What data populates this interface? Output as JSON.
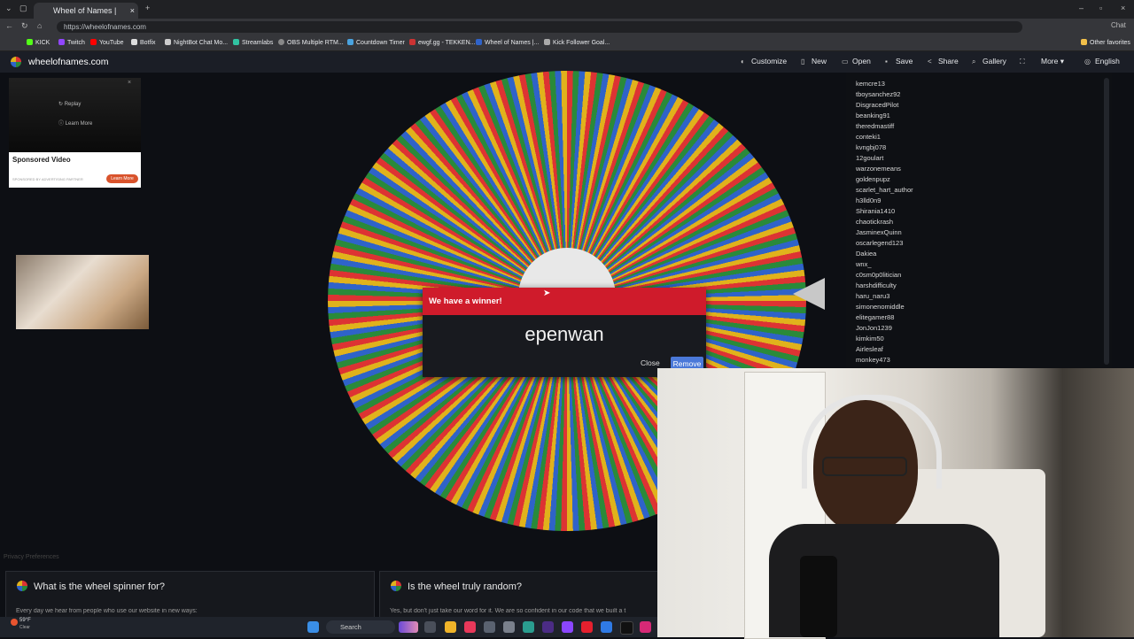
{
  "browser": {
    "tabs": [
      {
        "label": "Wheel of Names | Random name"
      }
    ],
    "url": "https://wheelofnames.com",
    "bookmarks": [
      "KICK",
      "Twitch",
      "YouTube",
      "Botfix",
      "NightBot Chat Mo...",
      "Streamlabs",
      "OBS Multiple RTM...",
      "Countdown Timer",
      "ewgf.gg - TEKKEN...",
      "Wheel of Names |...",
      "Kick Follower Goal..."
    ],
    "other_favorites": "Other favorites",
    "chat_label": "Chat",
    "colors": {
      "chrome_dark": "#202124",
      "chrome_mid": "#35363a"
    }
  },
  "site": {
    "logo": "wheelofnames.com",
    "nav": [
      {
        "label": "Customize",
        "icon": "palette-icon"
      },
      {
        "label": "New",
        "icon": "file-icon"
      },
      {
        "label": "Open",
        "icon": "folder-icon"
      },
      {
        "label": "Save",
        "icon": "save-icon"
      },
      {
        "label": "Share",
        "icon": "share-icon"
      },
      {
        "label": "Gallery",
        "icon": "search-icon"
      },
      {
        "label": "",
        "icon": "fullscreen-icon"
      },
      {
        "label": "More",
        "icon": "chevron-down-icon"
      },
      {
        "label": "English",
        "icon": "globe-icon"
      }
    ]
  },
  "ads": {
    "video_replay": "Replay",
    "video_learn": "Learn More",
    "sponsored_label": "Sponsored Video",
    "sponsor_caption": "SPONSORED BY ADVERTISING PARTNER",
    "learn_more_button": "Learn More",
    "privacy": "Privacy Preferences"
  },
  "names_list": [
    "kemcre13",
    "tboysanchez92",
    "DisgracedPilot",
    "beanking91",
    "theredmastiff",
    "conteki1",
    "kvngbj078",
    "12goulart",
    "warzonemeans",
    "goldenpupz",
    "scarlet_hart_author",
    "h3lld0n9",
    "Shirania1410",
    "chaotickrash",
    "JasminexQuinn",
    "oscarlegend123",
    "Dakiea",
    "wnx_",
    "c0sm0p0litician",
    "harshdifficulty",
    "haru_naru3",
    "simonenomiddle",
    "elitegamer88",
    "JonJon1239",
    "kimkim50",
    "Airlesleaf",
    "monkey473"
  ],
  "dialog": {
    "title": "We have a winner!",
    "winner": "epenwan",
    "close_label": "Close",
    "remove_label": "Remove",
    "header_color": "#cf1b2b",
    "remove_color": "#4a78d8"
  },
  "wheel": {
    "segment_colors": [
      "#d33",
      "#2a8a3a",
      "#2f63c9",
      "#e0b21c"
    ]
  },
  "faq": [
    {
      "title": "What is the wheel spinner for?",
      "text": "Every day we hear from people who use our website in new ways:"
    },
    {
      "title": "Is the wheel truly random?",
      "text": "Yes, but don't just take our word for it. We are so confident in our code that we built a t"
    }
  ],
  "taskbar": {
    "search_placeholder": "Search",
    "weather": "59°F",
    "weather_desc": "Clear"
  }
}
